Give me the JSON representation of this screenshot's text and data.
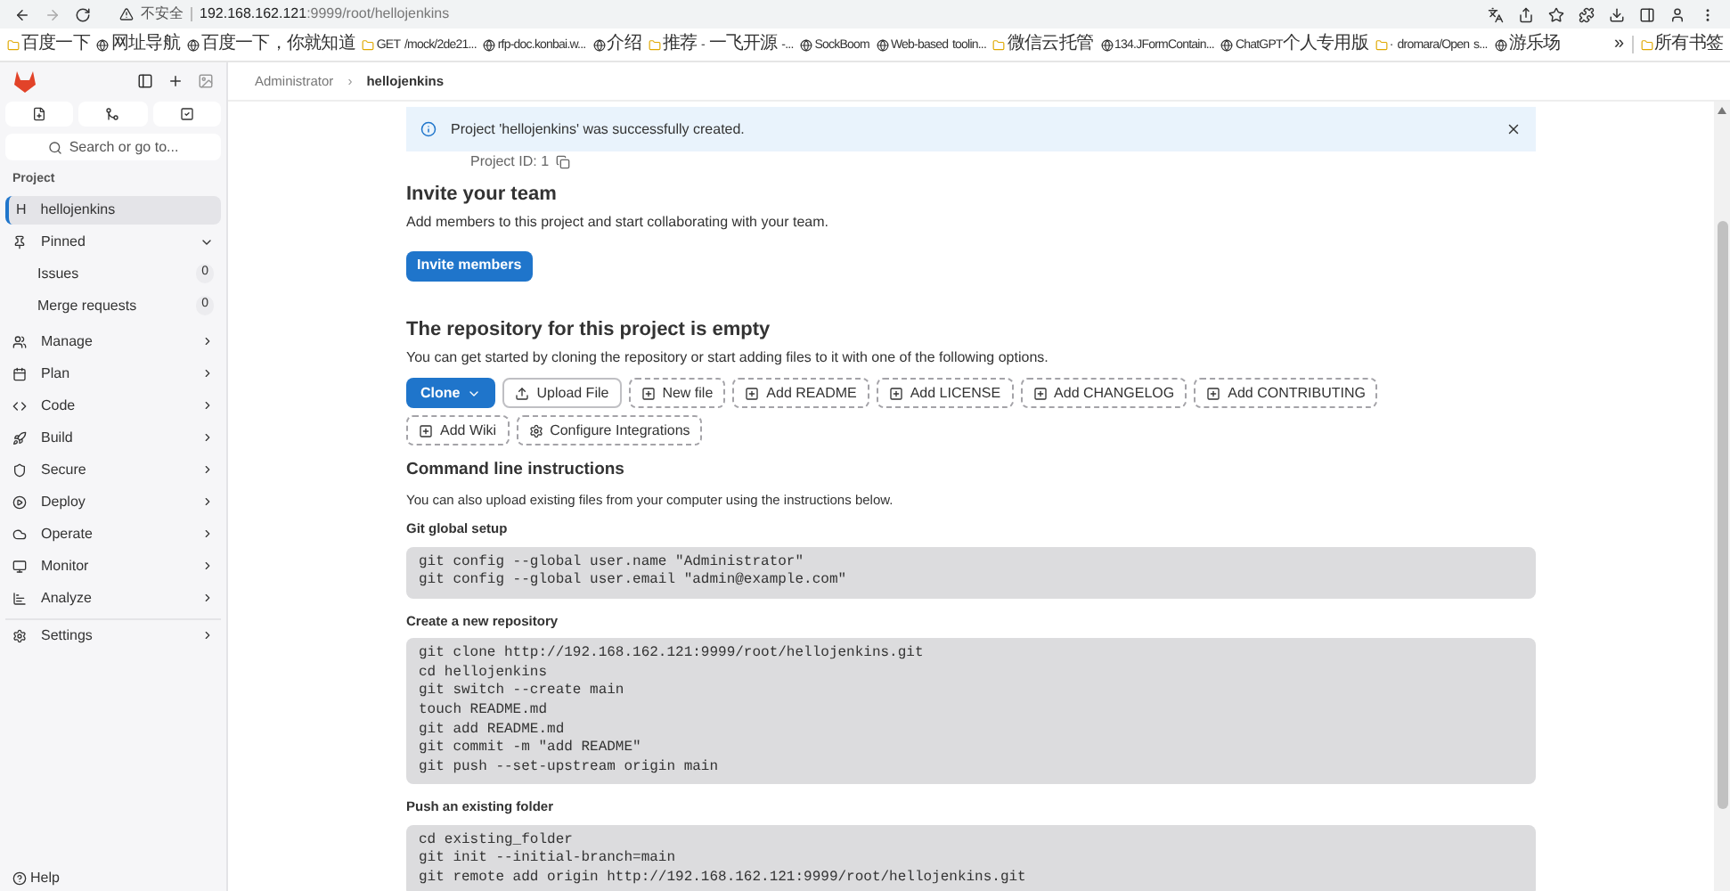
{
  "browser": {
    "security_label": "不安全",
    "url_host": "192.168.162.121",
    "url_rest": ":9999/root/hellojenkins"
  },
  "bookmarks": [
    {
      "label": "百度一下"
    },
    {
      "label": "网址导航"
    },
    {
      "label": "百度一下，你就知道"
    },
    {
      "label": "GET /mock/2de21..."
    },
    {
      "label": "rfp-doc.konbai.w..."
    },
    {
      "label": "介绍"
    },
    {
      "label": "推荐 - 一飞开源 -..."
    },
    {
      "label": "SockBoom"
    },
    {
      "label": "Web-based toolin..."
    },
    {
      "label": "微信云托管"
    },
    {
      "label": "134.JFormContain..."
    },
    {
      "label": "ChatGPT个人专用版"
    },
    {
      "label": "· dromara/Open s..."
    },
    {
      "label": "游乐场"
    }
  ],
  "bookmarks_more": "»",
  "all_bookmarks": "所有书签",
  "breadcrumb": [
    "Administrator",
    "hellojenkins"
  ],
  "breadcrumb_separator": "›",
  "sidebar": {
    "search_placeholder": "Search or go to...",
    "section_title": "Project",
    "project": {
      "initial": "H",
      "label": "hellojenkins",
      "selected": true
    },
    "pinned": {
      "label": "Pinned",
      "expanded": true,
      "children": [
        {
          "label": "Issues",
          "count": "0"
        },
        {
          "label": "Merge requests",
          "count": "0"
        }
      ]
    },
    "items": [
      {
        "label": "Manage"
      },
      {
        "label": "Plan"
      },
      {
        "label": "Code"
      },
      {
        "label": "Build"
      },
      {
        "label": "Secure"
      },
      {
        "label": "Deploy"
      },
      {
        "label": "Operate"
      },
      {
        "label": "Monitor"
      },
      {
        "label": "Analyze"
      },
      {
        "label": "Settings"
      }
    ],
    "help": "Help"
  },
  "alert": {
    "message": "Project 'hellojenkins' was successfully created."
  },
  "project_id": "Project ID: 1",
  "invite": {
    "title": "Invite your team",
    "text": "Add members to this project and start collaborating with your team.",
    "button": "Invite members"
  },
  "empty_repo": {
    "title": "The repository for this project is empty",
    "text": "You can get started by cloning the repository or start adding files to it with one of the following options.",
    "actions": [
      {
        "label": "Clone",
        "kind": "primary"
      },
      {
        "label": "Upload File",
        "kind": "upload"
      },
      {
        "label": "New file",
        "kind": "dashed"
      },
      {
        "label": "Add README",
        "kind": "dashed"
      },
      {
        "label": "Add LICENSE",
        "kind": "dashed"
      },
      {
        "label": "Add CHANGELOG",
        "kind": "dashed"
      },
      {
        "label": "Add CONTRIBUTING",
        "kind": "dashed"
      },
      {
        "label": "Add Wiki",
        "kind": "dashed"
      },
      {
        "label": "Configure Integrations",
        "kind": "settings"
      }
    ]
  },
  "cli": {
    "title": "Command line instructions",
    "text": "You can also upload existing files from your computer using the instructions below.",
    "sections": [
      {
        "title": "Git global setup",
        "lines": [
          "git config --global user.name \"Administrator\"",
          "git config --global user.email \"admin@example.com\""
        ]
      },
      {
        "title": "Create a new repository",
        "lines": [
          "git clone http://192.168.162.121:9999/root/hellojenkins.git",
          "cd hellojenkins",
          "git switch --create main",
          "touch README.md",
          "git add README.md",
          "git commit -m \"add README\"",
          "git push --set-upstream origin main"
        ]
      },
      {
        "title": "Push an existing folder",
        "lines": [
          "cd existing_folder",
          "git init --initial-branch=main",
          "git remote add origin http://192.168.162.121:9999/root/hellojenkins.git"
        ]
      }
    ]
  }
}
